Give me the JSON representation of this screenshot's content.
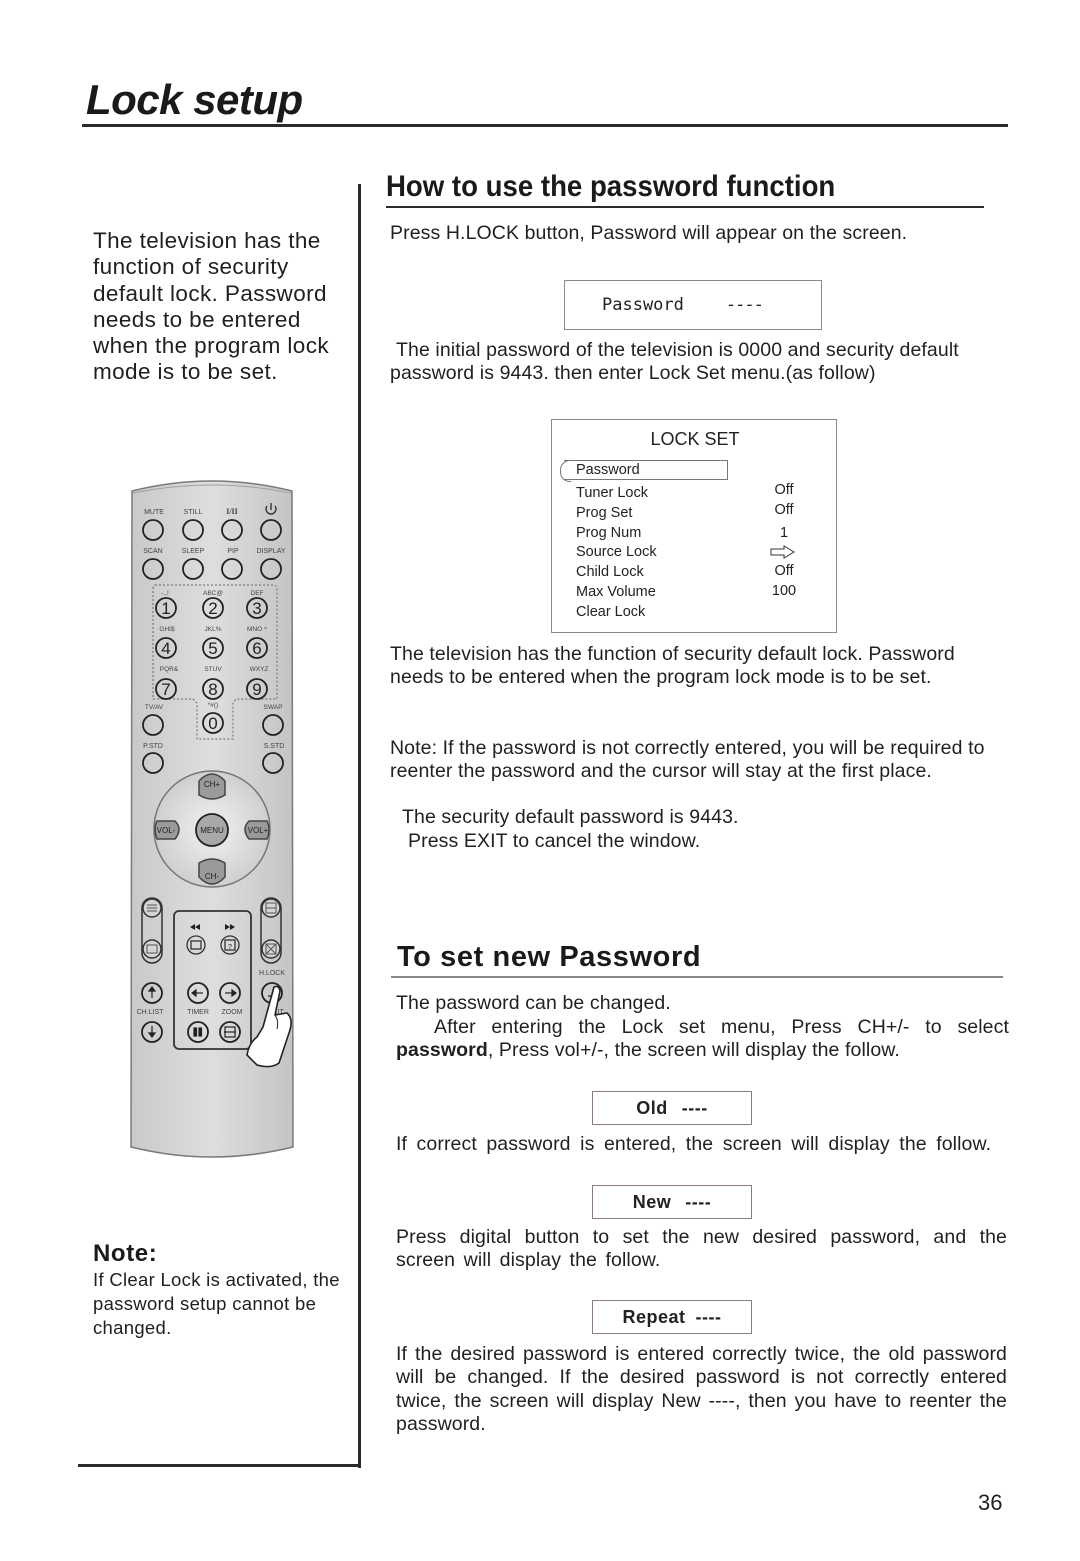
{
  "page": {
    "title": "Lock setup",
    "page_number": "36"
  },
  "left_column": {
    "intro": "The television has the function of security default lock. Password needs to be entered when the program lock mode is to be set.",
    "note_title": "Note:",
    "note_text": "If Clear Lock is activated, the password setup cannot be changed."
  },
  "remote": {
    "row1": [
      "MUTE",
      "STILL",
      "I/II",
      "power"
    ],
    "row2": [
      "SCAN",
      "SLEEP",
      "PIP",
      "DISPLAY"
    ],
    "digits": [
      {
        "num": "1",
        "letters": "-.,!"
      },
      {
        "num": "2",
        "letters": "ABC@"
      },
      {
        "num": "3",
        "letters": "DEF"
      },
      {
        "num": "4",
        "letters": "GHI$"
      },
      {
        "num": "5",
        "letters": "JKL%"
      },
      {
        "num": "6",
        "letters": "MNO^"
      },
      {
        "num": "7",
        "letters": "PQR&"
      },
      {
        "num": "8",
        "letters": "STUV"
      },
      {
        "num": "9",
        "letters": "WXYZ"
      },
      {
        "num": "0",
        "letters": "*#()"
      }
    ],
    "tv_av": "TV/AV",
    "swap": "SWAP",
    "p_std": "P.STD",
    "s_std": "S.STD",
    "ch_plus": "CH+",
    "ch_minus": "CH-",
    "vol_minus": "VOL-",
    "vol_plus": "VOL+",
    "menu": "MENU",
    "h_lock": "H.LOCK",
    "ch_list": "CH.LIST",
    "timer": "TIMER",
    "zoom": "ZOOM",
    "exit": "EXIT"
  },
  "section1": {
    "heading": "How to use the password function",
    "p1": "Press H.LOCK button, Password will appear on the screen.",
    "password_box": {
      "label": "Password",
      "value": "----"
    },
    "p2": "The initial password of the television is 0000 and security default password is 9443. then enter Lock Set menu.(as follow)",
    "lock_set": {
      "title": "LOCK SET",
      "items": [
        {
          "label": "Password",
          "value": ""
        },
        {
          "label": "Tuner Lock",
          "value": "Off"
        },
        {
          "label": "Prog Set",
          "value": "Off"
        },
        {
          "label": "Prog Num",
          "value": "1"
        },
        {
          "label": "Source Lock",
          "value": "arrow-right"
        },
        {
          "label": "Child Lock",
          "value": "Off"
        },
        {
          "label": "Max Volume",
          "value": "100"
        },
        {
          "label": "Clear Lock",
          "value": ""
        }
      ]
    },
    "p3": "The television has the function of security default lock. Password needs to be entered when the program lock mode is to be set.",
    "p4": "Note: If the password is not correctly entered, you will be required to reenter the password and the cursor will stay at the first place.",
    "p5": "The security default password is 9443.",
    "p6": "Press EXIT to cancel the window."
  },
  "section2": {
    "heading": "To set new Password",
    "p1": "The password can be changed.",
    "p2_indent": "After entering the Lock set menu, Press CH+/- to select",
    "p2_bold": "password",
    "p2_rest": ", Press vol+/-, the screen will display the follow.",
    "old_box": {
      "label": "Old",
      "value": "----"
    },
    "p3": "If correct password is entered, the screen will display the follow.",
    "new_box": {
      "label": "New",
      "value": "----"
    },
    "p4": "Press digital button to set the new desired password, and the screen will display the follow.",
    "repeat_box": {
      "label": "Repeat",
      "value": "----"
    },
    "p5": "If the desired password is entered correctly twice, the old password will be changed. If the desired password is not correctly entered twice, the screen will display New ----, then you have to reenter the password."
  }
}
